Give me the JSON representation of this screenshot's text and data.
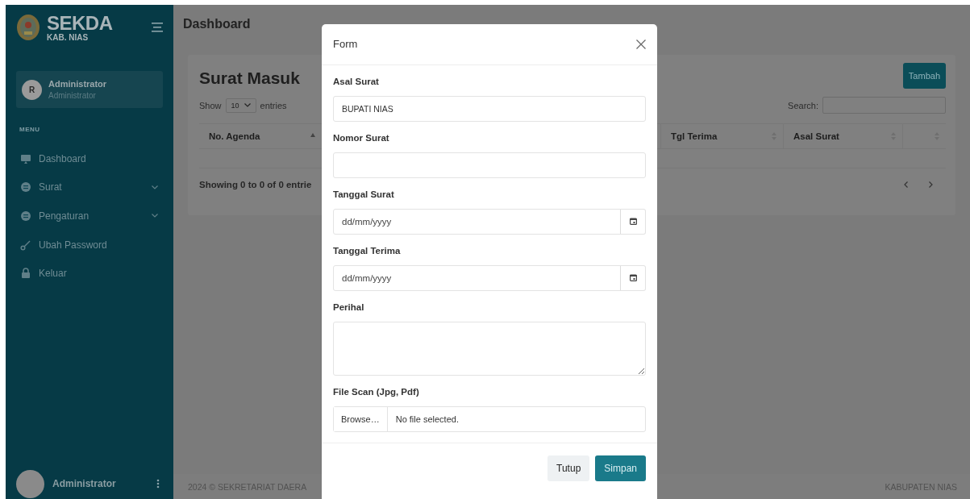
{
  "sidebar": {
    "brand": {
      "title": "SEKDA",
      "subtitle": "KAB. NIAS"
    },
    "user": {
      "initial": "R",
      "name": "Administrator",
      "role": "Administrator"
    },
    "menu_heading": "MENU",
    "items": [
      {
        "label": "Dashboard",
        "kind": "monitor",
        "has_submenu": false
      },
      {
        "label": "Surat",
        "kind": "chat",
        "has_submenu": true
      },
      {
        "label": "Pengaturan",
        "kind": "chat",
        "has_submenu": true
      },
      {
        "label": "Ubah Password",
        "kind": "key",
        "has_submenu": false
      },
      {
        "label": "Keluar",
        "kind": "lock",
        "has_submenu": false
      }
    ],
    "footer_user": {
      "name": "Administrator"
    }
  },
  "header": {
    "title": "Dashboard"
  },
  "card": {
    "title": "Surat Masuk",
    "add_button": "Tambah",
    "length": {
      "before": "Show",
      "value": "10",
      "after": "entries"
    },
    "search_label": "Search:",
    "columns": [
      {
        "label": "No. Agenda",
        "sorted": true
      },
      {
        "label": "Tgl Terima",
        "sorted": false
      },
      {
        "label": "Asal Surat",
        "sorted": false
      },
      {
        "sorted": false
      }
    ],
    "info": "Showing 0 to 0 of 0 entrie"
  },
  "footer": {
    "left": "2024 © SEKRETARIAT DAERA",
    "right": "KABUPATEN NIAS"
  },
  "modal": {
    "title": "Form",
    "fields": [
      {
        "kind": "text",
        "label": "Asal Surat",
        "value": "BUPATI NIAS"
      },
      {
        "kind": "text",
        "label": "Nomor Surat"
      },
      {
        "kind": "date",
        "label": "Tanggal Surat",
        "placeholder": "dd/mm/yyyy"
      },
      {
        "kind": "date",
        "label": "Tanggal Terima",
        "placeholder": "dd/mm/yyyy"
      },
      {
        "kind": "textarea",
        "label": "Perihal"
      },
      {
        "kind": "file",
        "label": "File Scan (Jpg, Pdf)",
        "button": "Browse…",
        "status": "No file selected."
      }
    ],
    "buttons": [
      {
        "label": "Tutup",
        "kind": "secondary"
      },
      {
        "label": "Simpan",
        "kind": "primary"
      }
    ]
  }
}
